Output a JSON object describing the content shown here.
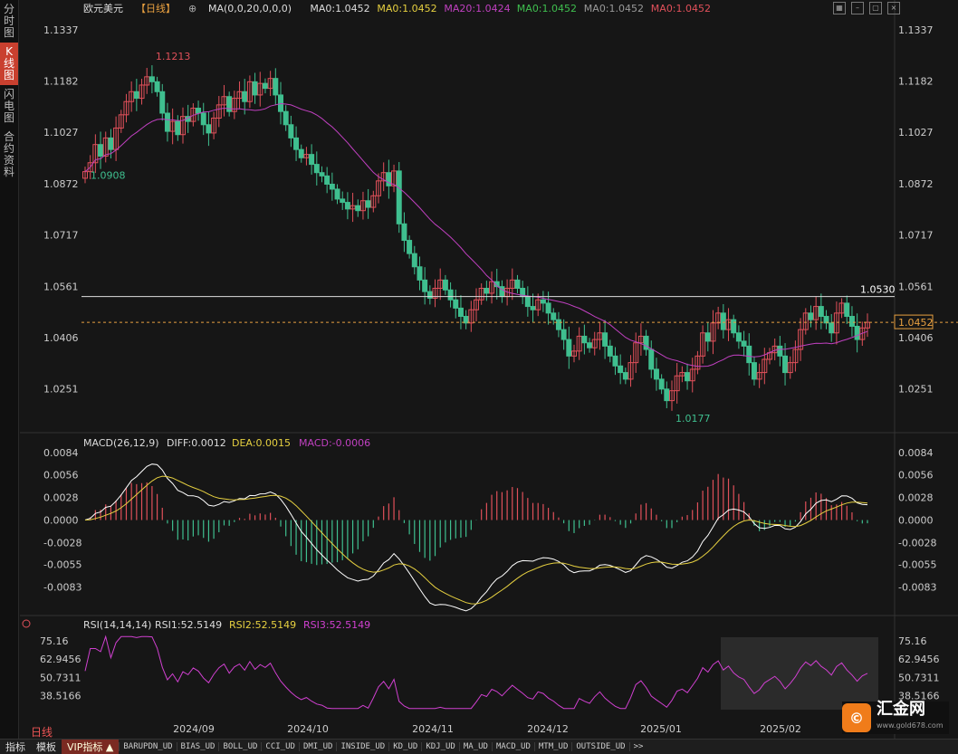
{
  "sidebar": {
    "tabs": [
      {
        "label": "分时图",
        "active": false
      },
      {
        "label": "K线图",
        "active": true
      },
      {
        "label": "闪电图",
        "active": false
      },
      {
        "label": "合约资料",
        "active": false
      }
    ]
  },
  "toolbar_icons": [
    "grid-icon",
    "minimize-icon",
    "restore-icon",
    "close-icon"
  ],
  "main_legend": {
    "symbol": "欧元美元",
    "period": "【日线】",
    "settings_icon": "⊕",
    "ma_params": "MA(0,0,20,0,0,0)",
    "ma1": "MA0:1.0452",
    "ma2": "MA0:1.0452",
    "ma3": "MA20:1.0424",
    "ma4": "MA0:1.0452",
    "ma5": "MA0:1.0452",
    "ma6": "MA0:1.0452"
  },
  "macd_legend": {
    "title": "MACD(26,12,9)",
    "diff": "DIFF:0.0012",
    "dea": "DEA:0.0015",
    "macd": "MACD:-0.0006"
  },
  "rsi_legend": {
    "title": "RSI(14,14,14)",
    "rsi1": "RSI1:52.5149",
    "rsi2": "RSI2:52.5149",
    "rsi3": "RSI3:52.5149"
  },
  "annotations": {
    "high": "1.1213",
    "low": "1.0177",
    "start": "1.0908",
    "hline": "1.0530",
    "current": "1.0452"
  },
  "period_label": "日线",
  "bottom_bar": [
    "指标",
    "模板",
    "VIP指标",
    "BARUPDN_UD",
    "BIAS_UD",
    "BOLL_UD",
    "CCI_UD",
    "DMI_UD",
    "INSIDE_UD",
    "KD_UD",
    "KDJ_UD",
    "MA_UD",
    "MACD_UD",
    "MTM_UD",
    "OUTSIDE_UD",
    ">>"
  ],
  "logo": {
    "text": "汇金网",
    "url": "www.gold678.com"
  },
  "colors": {
    "up": "#e0505a",
    "down": "#3fbf8f",
    "ma20": "#c040c0",
    "diff": "#ffffff",
    "dea": "#e6d040",
    "rsi": "#d040d0",
    "hline": "#ffffff",
    "current": "#e8a040"
  },
  "chart_data": [
    {
      "type": "candlestick",
      "title": "欧元美元 日线",
      "x_ticks": [
        "2024/09",
        "2024/10",
        "2024/11",
        "2024/12",
        "2025/01",
        "2025/02"
      ],
      "y_ticks": [
        1.1337,
        1.1182,
        1.1027,
        1.0872,
        1.0717,
        1.0561,
        1.0406,
        1.0251
      ],
      "ylim": [
        1.0177,
        1.1337
      ],
      "close_series": [
        1.0908,
        1.0935,
        1.099,
        1.0955,
        1.101,
        1.0975,
        1.104,
        1.108,
        1.112,
        1.115,
        1.113,
        1.117,
        1.1195,
        1.118,
        1.115,
        1.1085,
        1.103,
        1.106,
        1.102,
        1.1075,
        1.106,
        1.11,
        1.1085,
        1.105,
        1.1025,
        1.107,
        1.111,
        1.1135,
        1.109,
        1.113,
        1.115,
        1.112,
        1.118,
        1.114,
        1.1175,
        1.116,
        1.119,
        1.114,
        1.109,
        1.105,
        1.101,
        1.0975,
        1.095,
        1.096,
        1.093,
        1.0905,
        1.0895,
        1.087,
        1.0855,
        1.0825,
        1.0815,
        1.0795,
        1.0805,
        1.079,
        1.082,
        1.08,
        1.0835,
        1.088,
        1.0905,
        1.0865,
        1.091,
        1.075,
        1.07,
        1.066,
        1.062,
        1.058,
        1.0545,
        1.0525,
        1.0555,
        1.058,
        1.055,
        1.052,
        1.0495,
        1.047,
        1.045,
        1.049,
        1.052,
        1.0555,
        1.054,
        1.0575,
        1.056,
        1.053,
        1.0555,
        1.058,
        1.0555,
        1.053,
        1.05,
        1.049,
        1.052,
        1.051,
        1.048,
        1.046,
        1.043,
        1.04,
        1.035,
        1.0365,
        1.041,
        1.039,
        1.0375,
        1.04,
        1.042,
        1.038,
        1.035,
        1.032,
        1.03,
        1.028,
        1.033,
        1.039,
        1.041,
        1.037,
        1.031,
        1.028,
        1.025,
        1.0215,
        1.0245,
        1.029,
        1.03,
        1.0275,
        1.031,
        1.035,
        1.042,
        1.0395,
        1.045,
        1.048,
        1.043,
        1.046,
        1.042,
        1.0395,
        1.038,
        1.033,
        1.028,
        1.03,
        1.034,
        1.036,
        1.038,
        1.035,
        1.03,
        1.033,
        1.037,
        1.043,
        1.048,
        1.046,
        1.05,
        1.047,
        1.045,
        1.042,
        1.048,
        1.051,
        1.047,
        1.044,
        1.04,
        1.0435,
        1.0452
      ]
    },
    {
      "type": "line",
      "title": "MACD(26,12,9)",
      "y_ticks": [
        0.0084,
        0.0056,
        0.0028,
        0.0,
        -0.0028,
        -0.0055,
        -0.0083
      ],
      "ylim": [
        -0.0105,
        0.0095
      ],
      "series": [
        {
          "name": "DIFF"
        },
        {
          "name": "DEA"
        },
        {
          "name": "MACD"
        }
      ],
      "last": {
        "DIFF": 0.0012,
        "DEA": 0.0015,
        "MACD": -0.0006
      }
    },
    {
      "type": "line",
      "title": "RSI(14,14,14)",
      "y_ticks": [
        75.16,
        62.9456,
        50.7311,
        38.5166
      ],
      "ylim": [
        28,
        80
      ],
      "last": {
        "RSI1": 52.5149,
        "RSI2": 52.5149,
        "RSI3": 52.5149
      }
    }
  ]
}
